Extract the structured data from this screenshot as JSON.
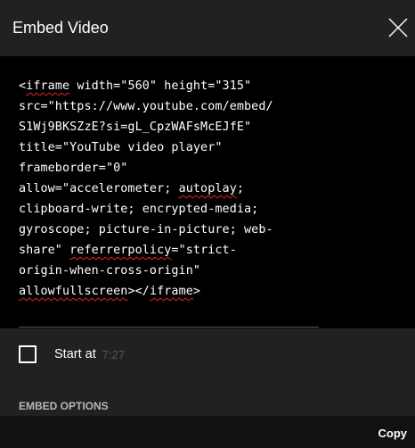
{
  "dialog": {
    "title": "Embed Video",
    "close_icon": "close-icon"
  },
  "code": {
    "lines": [
      [
        "<",
        {
          "text": "iframe",
          "flag": true
        },
        " width=\"560\" height=\"315\""
      ],
      [
        "src=\"https://www.youtube.com/embed/"
      ],
      [
        "S1Wj9BKSZzE?si=gL_CpzWAFsMcEJfE\""
      ],
      [
        "title=\"YouTube video player\""
      ],
      [
        "frameborder=\"0\""
      ],
      [
        "allow=\"accelerometer; ",
        {
          "text": "autoplay",
          "flag": true
        },
        ";"
      ],
      [
        "clipboard-write; encrypted-media;"
      ],
      [
        "gyroscope; picture-in-picture; web-"
      ],
      [
        "share\" ",
        {
          "text": "referrerpolicy",
          "flag": true
        },
        "=\"strict-"
      ],
      [
        "origin-when-cross-origin\""
      ],
      [
        {
          "text": "allowfullscreen",
          "flag": true
        },
        "></",
        {
          "text": "iframe",
          "flag": true
        },
        ">"
      ]
    ]
  },
  "start_at": {
    "label": "Start at",
    "time": "7:27",
    "checked": false
  },
  "embed_options": {
    "label": "EMBED OPTIONS"
  },
  "footer": {
    "copy_label": "Copy"
  },
  "colors": {
    "dialog_bg": "#212121",
    "code_bg": "#000000",
    "footer_bg": "#111111",
    "spellcheck_underline": "#e52222",
    "muted_text": "#555555"
  }
}
